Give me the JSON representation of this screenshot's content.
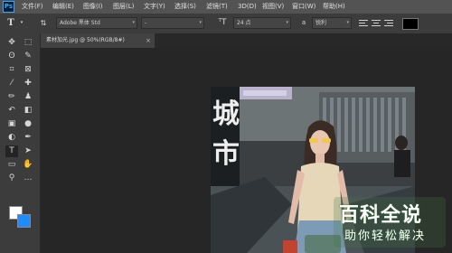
{
  "app": {
    "logo_text": "Ps"
  },
  "menu": [
    {
      "label": "文件(F)"
    },
    {
      "label": "编辑(E)"
    },
    {
      "label": "图像(I)"
    },
    {
      "label": "图层(L)"
    },
    {
      "label": "文字(Y)"
    },
    {
      "label": "选择(S)"
    },
    {
      "label": "滤镜(T)"
    },
    {
      "label": "3D(D)"
    },
    {
      "label": "视图(V)"
    },
    {
      "label": "窗口(W)"
    },
    {
      "label": "帮助(H)"
    }
  ],
  "options": {
    "font_family": "Adobe 黑体 Std",
    "font_style": "-",
    "font_size": "24 点",
    "aa_label": "a",
    "aa_mode": "锐利",
    "color": "#000000"
  },
  "document": {
    "tab_title": "素材加光.jpg @ 50%(RGB/8#)",
    "close_glyph": "×"
  },
  "toolbar": {
    "foreground_color": "#ffffff",
    "background_color": "#1e8cff",
    "tools": [
      {
        "name": "move-tool-icon",
        "glyph": "✥"
      },
      {
        "name": "marquee-tool-icon",
        "glyph": "⬚"
      },
      {
        "name": "lasso-tool-icon",
        "glyph": "ʘ"
      },
      {
        "name": "quick-select-tool-icon",
        "glyph": "✎"
      },
      {
        "name": "crop-tool-icon",
        "glyph": "⌗"
      },
      {
        "name": "frame-tool-icon",
        "glyph": "⊠"
      },
      {
        "name": "eyedropper-tool-icon",
        "glyph": "⁄"
      },
      {
        "name": "healing-tool-icon",
        "glyph": "✚"
      },
      {
        "name": "brush-tool-icon",
        "glyph": "✏"
      },
      {
        "name": "stamp-tool-icon",
        "glyph": "♟"
      },
      {
        "name": "history-brush-icon",
        "glyph": "↶"
      },
      {
        "name": "eraser-tool-icon",
        "glyph": "◧"
      },
      {
        "name": "gradient-tool-icon",
        "glyph": "▣"
      },
      {
        "name": "blur-tool-icon",
        "glyph": "●"
      },
      {
        "name": "dodge-tool-icon",
        "glyph": "◐"
      },
      {
        "name": "pen-tool-icon",
        "glyph": "✒"
      },
      {
        "name": "type-tool-icon",
        "glyph": "T"
      },
      {
        "name": "path-select-tool-icon",
        "glyph": "➤"
      },
      {
        "name": "shape-tool-icon",
        "glyph": "▭"
      },
      {
        "name": "hand-tool-icon",
        "glyph": "✋"
      },
      {
        "name": "zoom-tool-icon",
        "glyph": "⚲"
      },
      {
        "name": "more-tools-icon",
        "glyph": "…"
      }
    ]
  },
  "watermark": {
    "title": "百科全说",
    "subtitle": "助你轻松解决"
  }
}
